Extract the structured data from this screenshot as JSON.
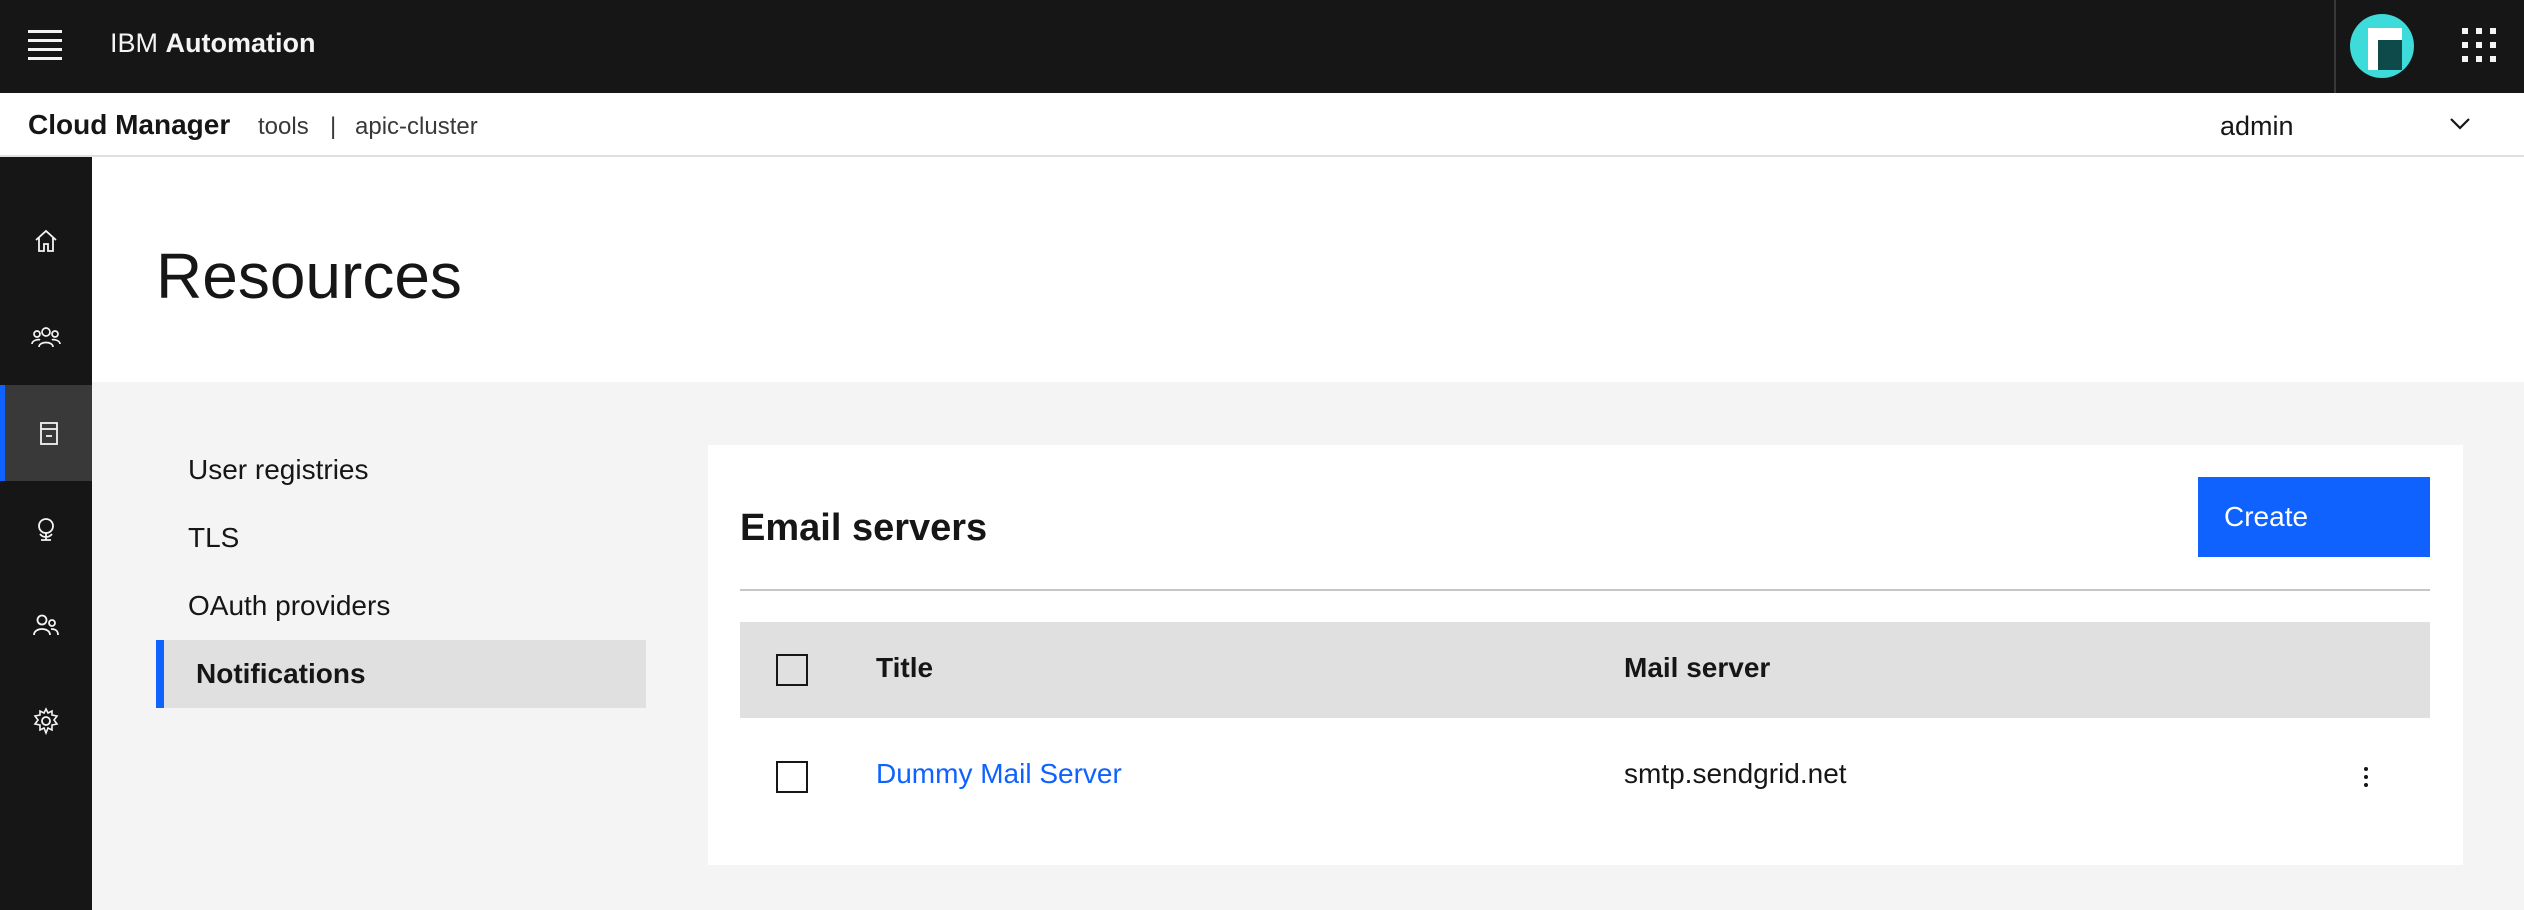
{
  "header": {
    "brand_light": "IBM",
    "brand_strong": "Automation"
  },
  "subheader": {
    "app_name": "Cloud Manager",
    "crumb_org": "tools",
    "crumb_sep": "|",
    "crumb_cluster": "apic-cluster",
    "user": "admin"
  },
  "rail": {
    "items": [
      {
        "icon": "home-icon"
      },
      {
        "icon": "users-icon"
      },
      {
        "icon": "resources-icon",
        "active": true
      },
      {
        "icon": "topology-icon"
      },
      {
        "icon": "members-icon"
      },
      {
        "icon": "settings-icon"
      }
    ]
  },
  "page": {
    "title": "Resources"
  },
  "side_nav": {
    "items": [
      {
        "label": "User registries"
      },
      {
        "label": "TLS"
      },
      {
        "label": "OAuth providers"
      },
      {
        "label": "Notifications",
        "active": true
      }
    ]
  },
  "panel": {
    "title": "Email servers",
    "create_label": "Create",
    "columns": [
      "Title",
      "Mail server"
    ],
    "rows": [
      {
        "title": "Dummy Mail Server",
        "mail_server": "smtp.sendgrid.net"
      }
    ]
  },
  "colors": {
    "accent": "#0f62fe",
    "header_bg": "#161616",
    "content_bg": "#f4f4f4"
  }
}
